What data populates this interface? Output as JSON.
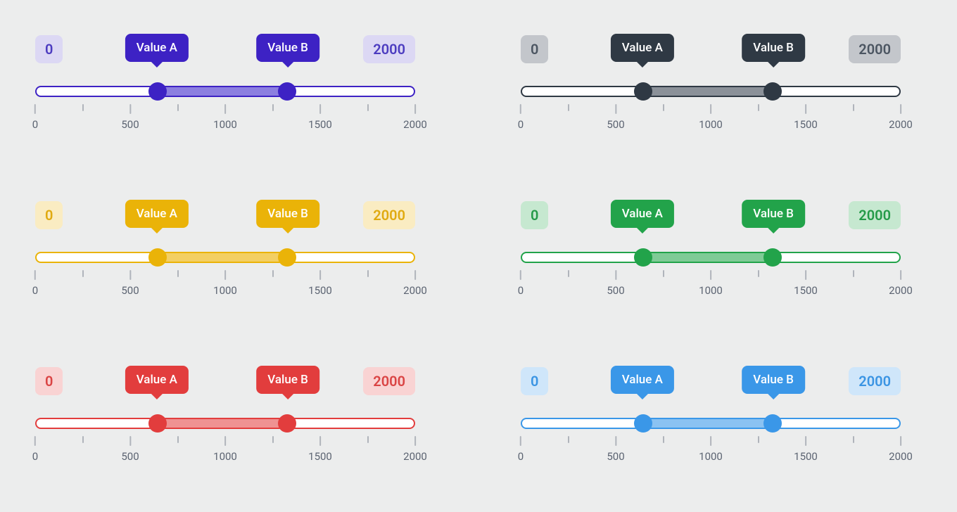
{
  "scale": {
    "min": 0,
    "max": 2000
  },
  "ticks": [
    {
      "v": 0,
      "label": "0"
    },
    {
      "v": 250,
      "label": ""
    },
    {
      "v": 500,
      "label": "500"
    },
    {
      "v": 750,
      "label": ""
    },
    {
      "v": 1000,
      "label": "1000"
    },
    {
      "v": 1250,
      "label": ""
    },
    {
      "v": 1500,
      "label": "1500"
    },
    {
      "v": 1750,
      "label": ""
    },
    {
      "v": 2000,
      "label": "2000"
    }
  ],
  "sliders": [
    {
      "id": "purple",
      "min_label": "0",
      "max_label": "2000",
      "tooltip_a": "Value A",
      "tooltip_b": "Value B",
      "value_a": 640,
      "value_b": 1330,
      "colors": {
        "primary": "#3d22c4",
        "mid": "#8c7fe0",
        "light": "#dcd8f4",
        "text": "#4c3cc0"
      }
    },
    {
      "id": "gray",
      "min_label": "0",
      "max_label": "2000",
      "tooltip_a": "Value A",
      "tooltip_b": "Value B",
      "value_a": 640,
      "value_b": 1330,
      "colors": {
        "primary": "#2f3944",
        "mid": "#8b9199",
        "light": "#c3c6cb",
        "text": "#4b5561"
      }
    },
    {
      "id": "amber",
      "min_label": "0",
      "max_label": "2000",
      "tooltip_a": "Value A",
      "tooltip_b": "Value B",
      "value_a": 640,
      "value_b": 1330,
      "colors": {
        "primary": "#eab308",
        "mid": "#f3cf63",
        "light": "#faecc2",
        "text": "#e0aa10"
      }
    },
    {
      "id": "green",
      "min_label": "0",
      "max_label": "2000",
      "tooltip_a": "Value A",
      "tooltip_b": "Value B",
      "value_a": 640,
      "value_b": 1330,
      "colors": {
        "primary": "#22a34a",
        "mid": "#7fcb96",
        "light": "#c6e8d0",
        "text": "#249a48"
      }
    },
    {
      "id": "red",
      "min_label": "0",
      "max_label": "2000",
      "tooltip_a": "Value A",
      "tooltip_b": "Value B",
      "value_a": 640,
      "value_b": 1330,
      "colors": {
        "primary": "#e23d3d",
        "mid": "#ef9292",
        "light": "#f9d3d3",
        "text": "#da4444"
      }
    },
    {
      "id": "blue",
      "min_label": "0",
      "max_label": "2000",
      "tooltip_a": "Value A",
      "tooltip_b": "Value B",
      "value_a": 640,
      "value_b": 1330,
      "colors": {
        "primary": "#3a97e8",
        "mid": "#8ac2f2",
        "light": "#cfe6fa",
        "text": "#3a94e3"
      }
    }
  ]
}
